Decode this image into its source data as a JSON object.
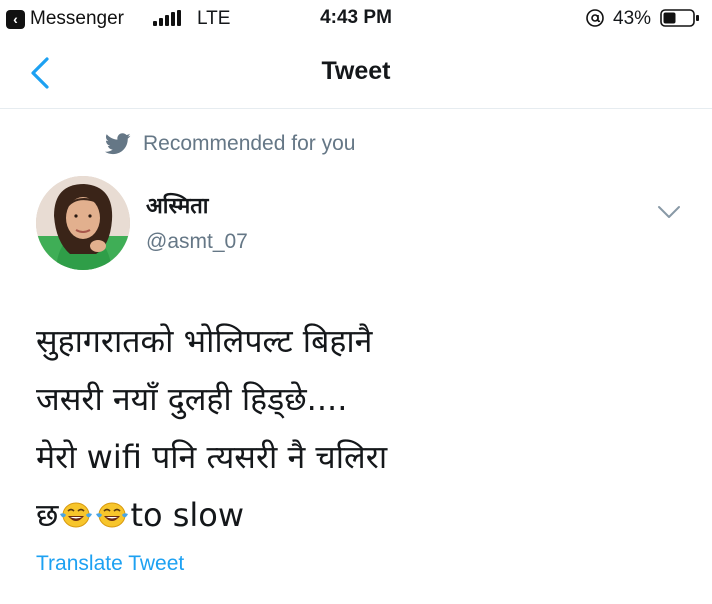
{
  "status_bar": {
    "back_app": "Messenger",
    "network": "LTE",
    "time": "4:43 PM",
    "battery_percent": "43%",
    "battery_level": 0.43
  },
  "nav": {
    "title": "Tweet",
    "back_icon": "chevron-left-icon"
  },
  "recommendation": {
    "label": "Recommended for you",
    "icon": "twitter-bird-icon"
  },
  "author": {
    "display_name": "अस्मिता",
    "handle": "@asmt_07"
  },
  "tweet": {
    "line1": "सुहागरातको भोलिपल्ट बिहानै",
    "line2": "जसरी नयाँ दुलही हिड्छे....",
    "line3": "मेरो wifi पनि त्यसरी नै चलिरा",
    "line4_start": "छ",
    "line4_end": "to slow",
    "emoji": "face-with-tears-of-joy-icon"
  },
  "translate_label": "Translate Tweet",
  "colors": {
    "accent": "#1da1f2",
    "secondary_text": "#657786",
    "primary_text": "#14171a",
    "divider": "#e6ecf0"
  }
}
